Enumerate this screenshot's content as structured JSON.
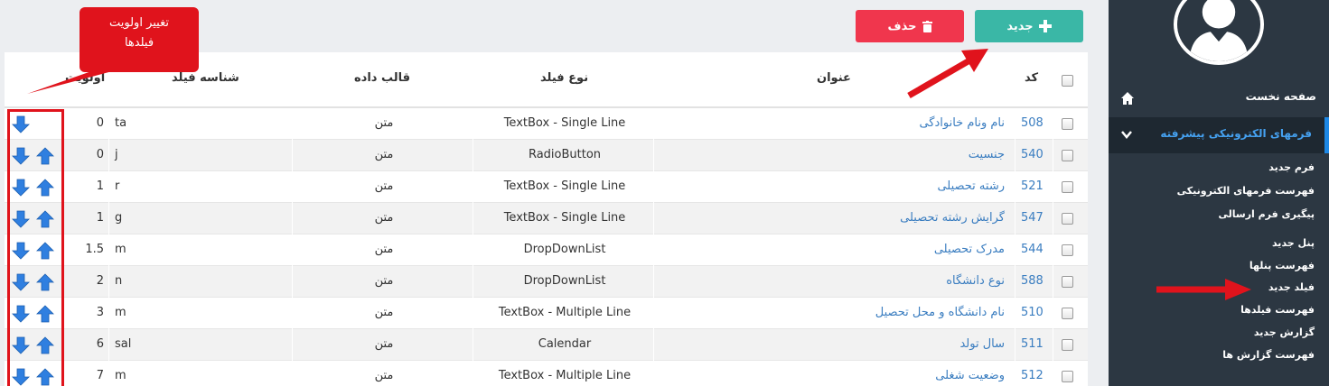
{
  "sidebar": {
    "home_label": "صفحه نخست",
    "active_section": "فرمهای الکترونیکی پیشرفته",
    "items": [
      {
        "label": "فرم جدید"
      },
      {
        "label": "فهرست فرمهای الکترونیکی"
      },
      {
        "label": "پیگیری فرم ارسالی"
      },
      {
        "label": "پنل جدید"
      },
      {
        "label": "فهرست پنلها"
      },
      {
        "label": "فیلد جدید"
      },
      {
        "label": "فهرست فیلدها"
      },
      {
        "label": "گزارش جدید"
      },
      {
        "label": "فهرست گزارش ها"
      }
    ]
  },
  "toolbar": {
    "new_label": "جدید",
    "delete_label": "حذف"
  },
  "annotation": {
    "callout_line1": "تغییر اولویت",
    "callout_line2": "فیلدها"
  },
  "table": {
    "headers": {
      "code": "کد",
      "title": "عنوان",
      "type": "نوع فیلد",
      "format": "قالب داده",
      "ident": "شناسه فیلد",
      "priority": "اولویت"
    },
    "rows": [
      {
        "code": "508",
        "title": "نام ونام خانوادگی",
        "type": "TextBox - Single Line",
        "format": "متن",
        "ident": "ta",
        "priority": "0"
      },
      {
        "code": "540",
        "title": "جنسیت",
        "type": "RadioButton",
        "format": "متن",
        "ident": "j",
        "priority": "0"
      },
      {
        "code": "521",
        "title": "رشته تحصیلی",
        "type": "TextBox - Single Line",
        "format": "متن",
        "ident": "r",
        "priority": "1"
      },
      {
        "code": "547",
        "title": "گرایش رشته تحصیلی",
        "type": "TextBox - Single Line",
        "format": "متن",
        "ident": "g",
        "priority": "1"
      },
      {
        "code": "544",
        "title": "مدرک تحصیلی",
        "type": "DropDownList",
        "format": "متن",
        "ident": "m",
        "priority": "1.5"
      },
      {
        "code": "588",
        "title": "نوع دانشگاه",
        "type": "DropDownList",
        "format": "متن",
        "ident": "n",
        "priority": "2"
      },
      {
        "code": "510",
        "title": "نام دانشگاه و محل تحصیل",
        "type": "TextBox - Multiple Line",
        "format": "متن",
        "ident": "m",
        "priority": "3"
      },
      {
        "code": "511",
        "title": "سال تولد",
        "type": "Calendar",
        "format": "متن",
        "ident": "sal",
        "priority": "6"
      },
      {
        "code": "512",
        "title": "وضعیت شغلی",
        "type": "TextBox - Multiple Line",
        "format": "متن",
        "ident": "m",
        "priority": "7"
      }
    ]
  },
  "colors": {
    "new_button": "#3ab7a6",
    "delete_button": "#f0364d",
    "sidebar_bg": "#2c3742",
    "link": "#3a7dc0",
    "annotation": "#e0131c",
    "arrow_icon": "#2f7fe0"
  }
}
